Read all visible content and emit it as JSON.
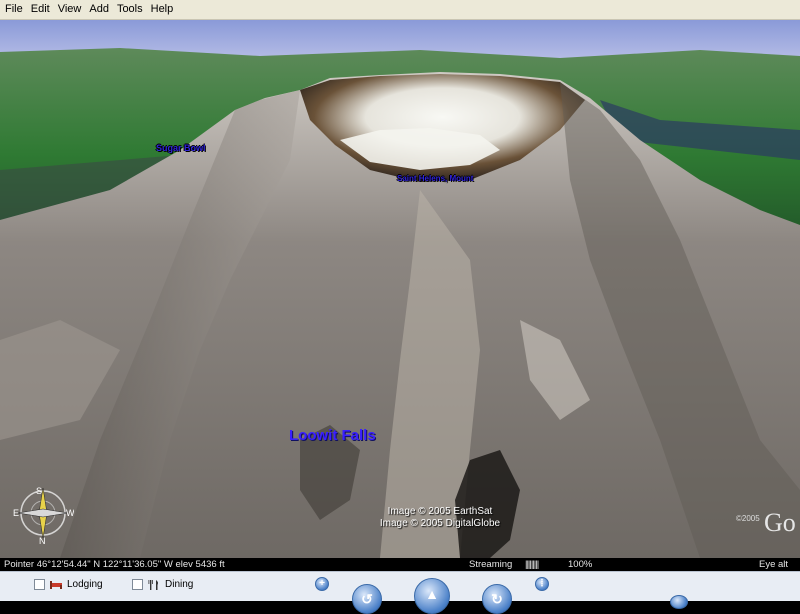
{
  "menu": {
    "items": [
      "File",
      "Edit",
      "View",
      "Add",
      "Tools",
      "Help"
    ]
  },
  "viewport": {
    "labels": {
      "sugar_bowl": "Sugar Bowl",
      "saint_helens": "Saint Helens, Mount",
      "loowit_falls": "Loowit Falls"
    },
    "credits": {
      "line1": "Image © 2005 EarthSat",
      "line2": "Image © 2005 DigitalGlobe"
    },
    "compass": {
      "n": "N",
      "s": "S",
      "e": "E",
      "w": "W"
    },
    "google_fragment": "©2005",
    "google_logo_fragment": "Go"
  },
  "statusbar": {
    "pointer": "Pointer  46°12'54.44\" N   122°11'36.05\" W   elev  5436 ft",
    "streaming": "Streaming",
    "stream_bars": "|||||||||",
    "stream_percent": "100%",
    "eye": "Eye  alt"
  },
  "layers": {
    "lodging": "Lodging",
    "dining": "Dining"
  },
  "colors": {
    "label_blue": "#2a1dd6",
    "panel_bg": "#e8edf4",
    "menubar_bg": "#ece9d8"
  }
}
